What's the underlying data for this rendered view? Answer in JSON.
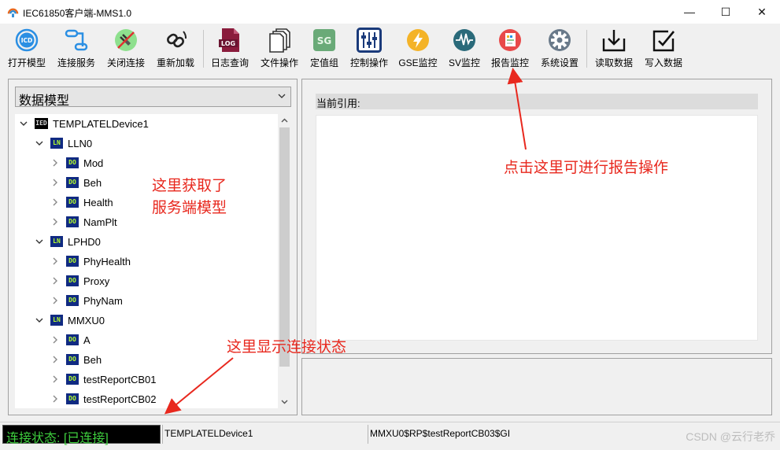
{
  "window": {
    "title": "IEC61850客户端-MMS1.0",
    "minimize_glyph": "—",
    "maximize_glyph": "☐",
    "close_glyph": "✕"
  },
  "toolbar": [
    {
      "label": "打开模型",
      "icon": "icd-open-icon"
    },
    {
      "label": "连接服务",
      "icon": "connect-icon"
    },
    {
      "label": "关闭连接",
      "icon": "disconnect-icon"
    },
    {
      "label": "重新加载",
      "icon": "reload-icon"
    },
    {
      "label": "日志查询",
      "icon": "log-icon",
      "badge": "LOG"
    },
    {
      "label": "文件操作",
      "icon": "file-icon"
    },
    {
      "label": "定值组",
      "icon": "setting-group-icon",
      "badge": "SG"
    },
    {
      "label": "控制操作",
      "icon": "control-icon"
    },
    {
      "label": "GSE监控",
      "icon": "gse-icon"
    },
    {
      "label": "SV监控",
      "icon": "sv-icon"
    },
    {
      "label": "报告监控",
      "icon": "report-icon"
    },
    {
      "label": "系统设置",
      "icon": "gear-icon"
    },
    {
      "label": "读取数据",
      "icon": "read-icon"
    },
    {
      "label": "写入数据",
      "icon": "write-icon"
    }
  ],
  "left_panel": {
    "combo_value": "数据模型",
    "tree": [
      {
        "label": "TEMPLATELDevice1",
        "badge": "IED",
        "level": 0,
        "expanded": true
      },
      {
        "label": "LLN0",
        "badge": "LN",
        "level": 1,
        "expanded": true
      },
      {
        "label": "Mod",
        "badge": "DO",
        "level": 2,
        "expanded": false
      },
      {
        "label": "Beh",
        "badge": "DO",
        "level": 2,
        "expanded": false
      },
      {
        "label": "Health",
        "badge": "DO",
        "level": 2,
        "expanded": false
      },
      {
        "label": "NamPlt",
        "badge": "DO",
        "level": 2,
        "expanded": false
      },
      {
        "label": "LPHD0",
        "badge": "LN",
        "level": 1,
        "expanded": true
      },
      {
        "label": "PhyHealth",
        "badge": "DO",
        "level": 2,
        "expanded": false
      },
      {
        "label": "Proxy",
        "badge": "DO",
        "level": 2,
        "expanded": false
      },
      {
        "label": "PhyNam",
        "badge": "DO",
        "level": 2,
        "expanded": false
      },
      {
        "label": "MMXU0",
        "badge": "LN",
        "level": 1,
        "expanded": true
      },
      {
        "label": "A",
        "badge": "DO",
        "level": 2,
        "expanded": false
      },
      {
        "label": "Beh",
        "badge": "DO",
        "level": 2,
        "expanded": false
      },
      {
        "label": "testReportCB01",
        "badge": "DO",
        "level": 2,
        "expanded": false
      },
      {
        "label": "testReportCB02",
        "badge": "DO",
        "level": 2,
        "expanded": false
      }
    ]
  },
  "right_panel": {
    "current_ref_label": "当前引用:"
  },
  "statusbar": {
    "connection": "连接状态: [已连接]",
    "device": "TEMPLATELDevice1",
    "reference": "MMXU0$RP$testReportCB03$GI",
    "watermark": "CSDN @云行老乔"
  },
  "annotations": {
    "model_note_line1": "这里获取了",
    "model_note_line2": "服务端模型",
    "report_note": "点击这里可进行报告操作",
    "status_note": "这里显示连接状态"
  },
  "colors": {
    "annotation": "#e8281e",
    "status_text": "#3ecf3e",
    "badge_bg": "#102a82",
    "badge_fg": "#b6ff2e"
  }
}
